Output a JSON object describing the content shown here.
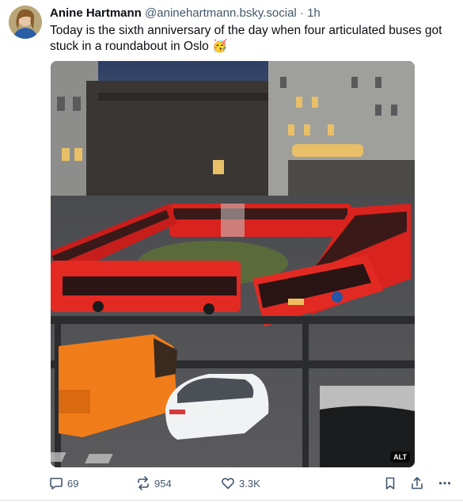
{
  "post": {
    "author_name": "Anine Hartmann",
    "author_handle": "@aninehartmann.bsky.social",
    "separator": "·",
    "time": "1h",
    "text": "Today is the sixth anniversary of the day when four articulated buses got stuck in a roundabout in Oslo 🥳",
    "media": {
      "alt_badge": "ALT"
    },
    "actions": {
      "reply_count": "69",
      "repost_count": "954",
      "like_count": "3.3K"
    }
  },
  "colors": {
    "text": "#0b0f14",
    "muted": "#42576c",
    "bus_red": "#d8231e",
    "van_orange": "#f07d1a"
  },
  "icons": [
    "avatar",
    "reply-icon",
    "repost-icon",
    "like-icon",
    "bookmark-icon",
    "share-icon",
    "more-icon"
  ]
}
